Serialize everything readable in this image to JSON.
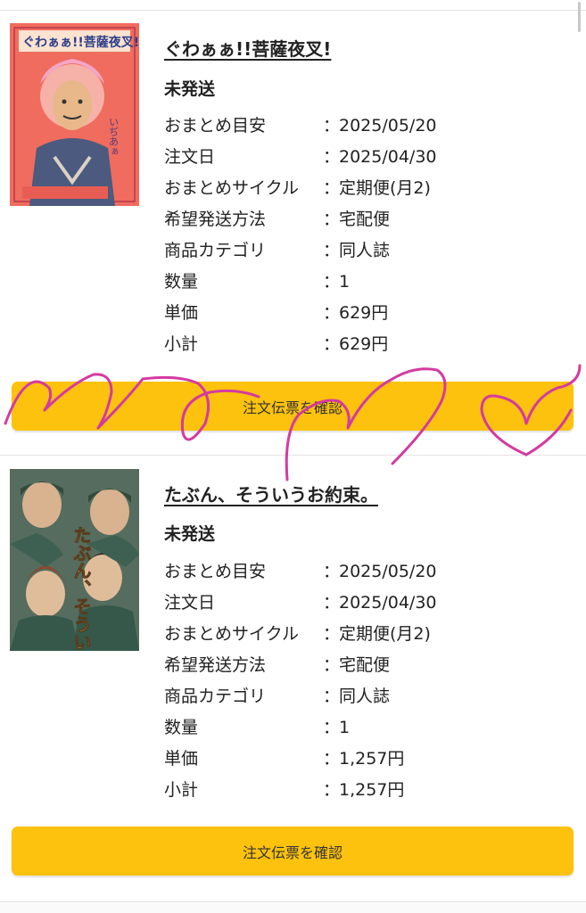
{
  "orders": [
    {
      "title": "ぐわぁぁ!!菩薩夜叉!",
      "status": "未発送",
      "cover": {
        "bg": "#f06c5e",
        "title_text": "ぐわぁぁ!!菩薩夜叉!",
        "side_text": "いぢあぁ"
      },
      "details": [
        {
          "label": "おまとめ目安",
          "value": "2025/05/20"
        },
        {
          "label": "注文日",
          "value": "2025/04/30"
        },
        {
          "label": "おまとめサイクル",
          "value": " 定期便(月2)"
        },
        {
          "label": "希望発送方法",
          "value": "宅配便"
        },
        {
          "label": "商品カテゴリ",
          "value": "同人誌"
        },
        {
          "label": "数量",
          "value": "1"
        },
        {
          "label": "単価",
          "value": "629円"
        },
        {
          "label": "小計",
          "value": "629円"
        }
      ],
      "button_label": "注文伝票を確認"
    },
    {
      "title": "たぶん、そういうお約束。",
      "status": "未発送",
      "cover": {
        "bg": "#4a6555",
        "title_text": "たぶん、そういうお約束。"
      },
      "details": [
        {
          "label": "おまとめ目安",
          "value": "2025/05/20"
        },
        {
          "label": "注文日",
          "value": "2025/04/30"
        },
        {
          "label": "おまとめサイクル",
          "value": " 定期便(月2)"
        },
        {
          "label": "希望発送方法",
          "value": "宅配便"
        },
        {
          "label": "商品カテゴリ",
          "value": "同人誌"
        },
        {
          "label": "数量",
          "value": "1"
        },
        {
          "label": "単価",
          "value": "1,257円"
        },
        {
          "label": "小計",
          "value": "1,257円"
        }
      ],
      "button_label": "注文伝票を確認"
    }
  ],
  "colon": "：",
  "colors": {
    "button": "#fcc20d",
    "scribble": "#d43aa0"
  }
}
